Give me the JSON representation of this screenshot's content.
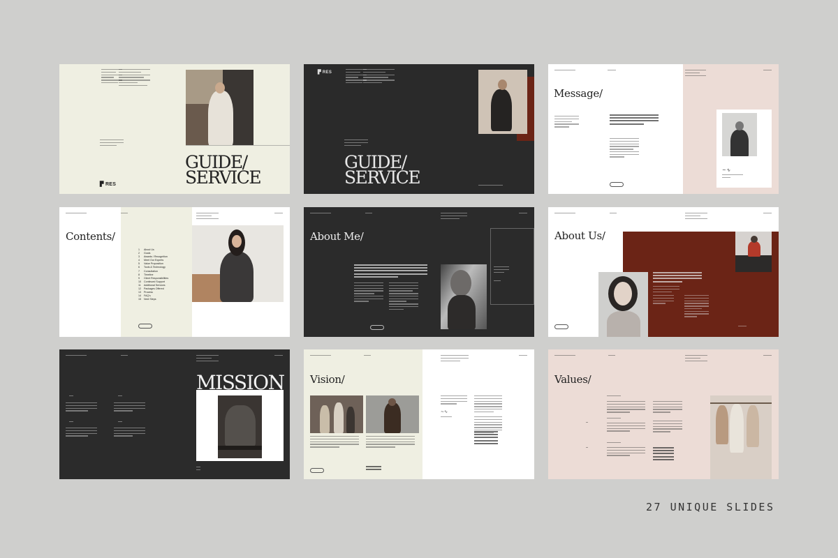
{
  "brand": {
    "logo_text": "RES"
  },
  "slides": {
    "cover_light": {
      "title_line1": "GUIDE/",
      "title_line2": "SERVICE"
    },
    "cover_dark": {
      "title_line1": "GUIDE/",
      "title_line2": "SERVICE"
    },
    "message": {
      "title": "Message/"
    },
    "contents": {
      "title": "Contents/",
      "items": [
        {
          "num": "1",
          "label": "About Us"
        },
        {
          "num": "2",
          "label": "Goals"
        },
        {
          "num": "3",
          "label": "Awards / Recognition"
        },
        {
          "num": "4",
          "label": "Meet Our Experts"
        },
        {
          "num": "5",
          "label": "Value Proposition"
        },
        {
          "num": "6",
          "label": "Tools & Technology"
        },
        {
          "num": "7",
          "label": "Consultation"
        },
        {
          "num": "8",
          "label": "Timeline"
        },
        {
          "num": "9",
          "label": "Client Responsibilities"
        },
        {
          "num": "10",
          "label": "Continued Support"
        },
        {
          "num": "11",
          "label": "Additional Services"
        },
        {
          "num": "12",
          "label": "Packages Offered"
        },
        {
          "num": "13",
          "label": "Process"
        },
        {
          "num": "14",
          "label": "FAQ's"
        },
        {
          "num": "15",
          "label": "Next Steps"
        }
      ]
    },
    "about_me": {
      "title": "About Me/"
    },
    "about_us": {
      "title": "About Us/"
    },
    "mission": {
      "title": "MISSION"
    },
    "vision": {
      "title": "Vision/"
    },
    "values": {
      "title": "Values/"
    }
  },
  "caption": "27 UNIQUE SLIDES",
  "colors": {
    "background": "#cfcfcd",
    "cream": "#efefe2",
    "charcoal": "#2b2b2b",
    "rust": "#6b2416",
    "blush": "#ecdcd6"
  }
}
